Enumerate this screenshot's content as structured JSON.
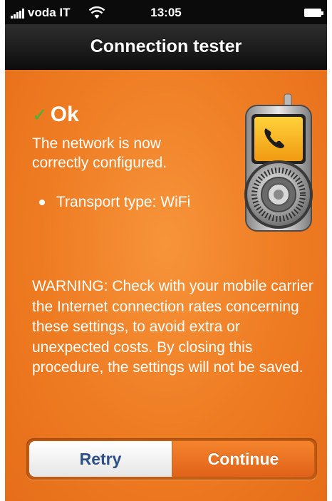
{
  "status_bar": {
    "carrier": "voda IT",
    "time": "13:05",
    "signal_icon": "signal-bars-icon",
    "wifi_icon": "wifi-icon",
    "battery_icon": "battery-icon"
  },
  "nav": {
    "title": "Connection tester"
  },
  "result": {
    "icon": "checkmark-icon",
    "check_glyph": "✓",
    "status": "Ok",
    "message": "The network is now correctly configured.",
    "details": [
      "Transport type: WiFi"
    ]
  },
  "warning": "WARNING: Check with your mobile carrier the Internet connection rates concerning these settings, to avoid extra or unexpected costs. By closing this procedure, the settings will not be saved.",
  "actions": {
    "retry_label": "Retry",
    "continue_label": "Continue"
  },
  "colors": {
    "background": "#f07a1e",
    "nav_bar": "#111111",
    "check": "#3fb53c",
    "retry_text": "#2c4f87",
    "continue_bg": "#e8701f"
  },
  "illustration": "phone-with-lock-icon"
}
